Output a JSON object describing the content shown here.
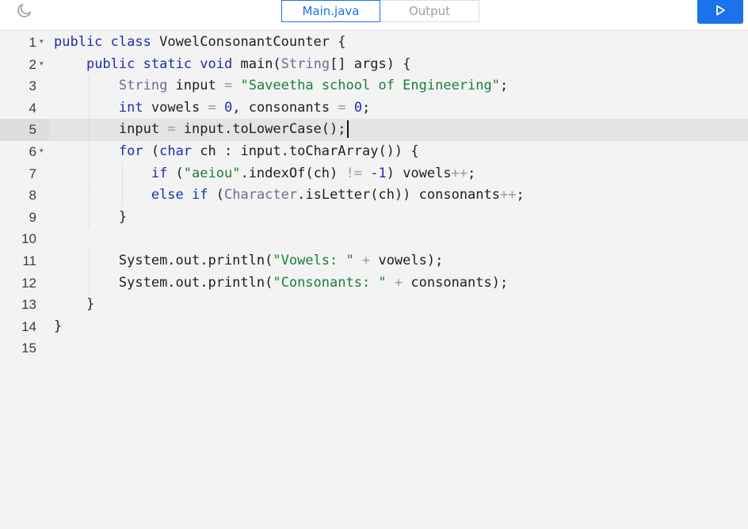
{
  "header": {
    "theme_icon": "moon-icon",
    "tabs": [
      {
        "label": "Main.java",
        "active": true
      },
      {
        "label": "Output",
        "active": false
      }
    ],
    "run_icon": "play-icon",
    "accent": "#1a73e8"
  },
  "editor": {
    "current_line": 5,
    "lines": [
      {
        "n": "1",
        "fold": "▾",
        "indent": "",
        "tokens": [
          [
            "kw",
            "public"
          ],
          [
            "",
            " "
          ],
          [
            "kw",
            "class"
          ],
          [
            "",
            " VowelConsonantCounter {"
          ]
        ]
      },
      {
        "n": "2",
        "fold": "▾",
        "indent": "    ",
        "tokens": [
          [
            "kw",
            "public"
          ],
          [
            "",
            " "
          ],
          [
            "kw",
            "static"
          ],
          [
            "",
            " "
          ],
          [
            "kw",
            "void"
          ],
          [
            "",
            " main("
          ],
          [
            "cls",
            "String"
          ],
          [
            "",
            "[] args) {"
          ]
        ]
      },
      {
        "n": "3",
        "fold": "",
        "indent": "        ",
        "tokens": [
          [
            "cls",
            "String"
          ],
          [
            "",
            " input "
          ],
          [
            "op",
            "="
          ],
          [
            "",
            " "
          ],
          [
            "st",
            "\"Saveetha school of Engineering\""
          ],
          [
            "",
            ";"
          ]
        ]
      },
      {
        "n": "4",
        "fold": "",
        "indent": "        ",
        "tokens": [
          [
            "ty",
            "int"
          ],
          [
            "",
            " vowels "
          ],
          [
            "op",
            "="
          ],
          [
            "",
            " "
          ],
          [
            "nm",
            "0"
          ],
          [
            "",
            ", consonants "
          ],
          [
            "op",
            "="
          ],
          [
            "",
            " "
          ],
          [
            "nm",
            "0"
          ],
          [
            "",
            ";"
          ]
        ]
      },
      {
        "n": "5",
        "fold": "",
        "indent": "        ",
        "tokens": [
          [
            "",
            "input "
          ],
          [
            "op",
            "="
          ],
          [
            "",
            " input.toLowerCase();"
          ]
        ]
      },
      {
        "n": "6",
        "fold": "▾",
        "indent": "        ",
        "tokens": [
          [
            "kw",
            "for"
          ],
          [
            "",
            " ("
          ],
          [
            "ty",
            "char"
          ],
          [
            "",
            " ch : input.toCharArray()) {"
          ]
        ]
      },
      {
        "n": "7",
        "fold": "",
        "indent": "            ",
        "tokens": [
          [
            "kw",
            "if"
          ],
          [
            "",
            " ("
          ],
          [
            "st",
            "\"aeiou\""
          ],
          [
            "",
            ".indexOf(ch) "
          ],
          [
            "op",
            "!="
          ],
          [
            "",
            " "
          ],
          [
            "nm",
            "-1"
          ],
          [
            "",
            ") vowels"
          ],
          [
            "op",
            "++"
          ],
          [
            "",
            ";"
          ]
        ]
      },
      {
        "n": "8",
        "fold": "",
        "indent": "            ",
        "tokens": [
          [
            "kw",
            "else"
          ],
          [
            "",
            " "
          ],
          [
            "kw",
            "if"
          ],
          [
            "",
            " ("
          ],
          [
            "cls",
            "Character"
          ],
          [
            "",
            ".isLetter(ch)) consonants"
          ],
          [
            "op",
            "++"
          ],
          [
            "",
            ";"
          ]
        ]
      },
      {
        "n": "9",
        "fold": "",
        "indent": "        ",
        "tokens": [
          [
            "",
            "}"
          ]
        ]
      },
      {
        "n": "10",
        "fold": "",
        "indent": "",
        "tokens": []
      },
      {
        "n": "11",
        "fold": "",
        "indent": "        ",
        "tokens": [
          [
            "",
            "System.out.println("
          ],
          [
            "st",
            "\"Vowels: \""
          ],
          [
            "",
            " "
          ],
          [
            "op",
            "+"
          ],
          [
            "",
            " vowels);"
          ]
        ]
      },
      {
        "n": "12",
        "fold": "",
        "indent": "        ",
        "tokens": [
          [
            "",
            "System.out.println("
          ],
          [
            "st",
            "\"Consonants: \""
          ],
          [
            "",
            " "
          ],
          [
            "op",
            "+"
          ],
          [
            "",
            " consonants);"
          ]
        ]
      },
      {
        "n": "13",
        "fold": "",
        "indent": "    ",
        "tokens": [
          [
            "",
            "}"
          ]
        ]
      },
      {
        "n": "14",
        "fold": "",
        "indent": "",
        "tokens": [
          [
            "",
            "}"
          ]
        ]
      },
      {
        "n": "15",
        "fold": "",
        "indent": "",
        "tokens": []
      }
    ]
  }
}
